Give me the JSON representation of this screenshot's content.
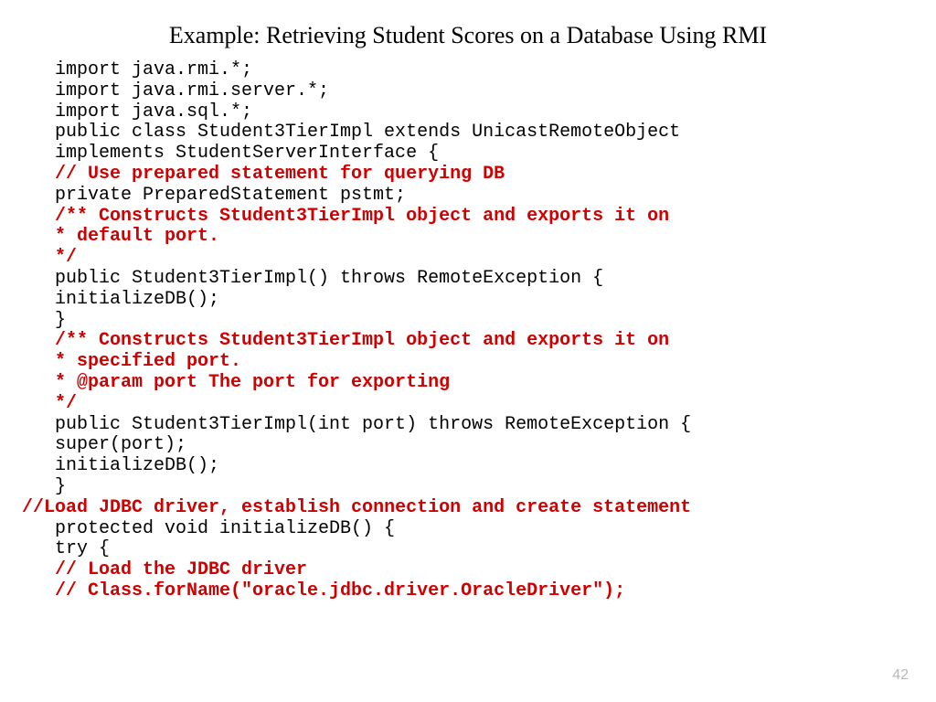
{
  "title": "Example: Retrieving Student Scores on a Database Using RMI",
  "lines": [
    {
      "t": "import java.rmi.*;",
      "cls": ""
    },
    {
      "t": "import java.rmi.server.*;",
      "cls": ""
    },
    {
      "t": "import java.sql.*;",
      "cls": ""
    },
    {
      "t": "public class Student3TierImpl extends UnicastRemoteObject",
      "cls": ""
    },
    {
      "t": "implements StudentServerInterface {",
      "cls": ""
    },
    {
      "t": "// Use prepared statement for querying DB",
      "cls": "red"
    },
    {
      "t": "private PreparedStatement pstmt;",
      "cls": ""
    },
    {
      "t": "/** Constructs Student3TierImpl object and exports it on",
      "cls": "red"
    },
    {
      "t": "* default port.",
      "cls": "red"
    },
    {
      "t": "*/",
      "cls": "red"
    },
    {
      "t": "public Student3TierImpl() throws RemoteException {",
      "cls": ""
    },
    {
      "t": "initializeDB();",
      "cls": ""
    },
    {
      "t": "}",
      "cls": ""
    },
    {
      "t": "/** Constructs Student3TierImpl object and exports it on",
      "cls": "red"
    },
    {
      "t": "* specified port.",
      "cls": "red"
    },
    {
      "t": "* @param port The port for exporting",
      "cls": "red"
    },
    {
      "t": "*/",
      "cls": "red"
    },
    {
      "t": "public Student3TierImpl(int port) throws RemoteException {",
      "cls": ""
    },
    {
      "t": "super(port);",
      "cls": ""
    },
    {
      "t": "initializeDB();",
      "cls": ""
    },
    {
      "t": "}",
      "cls": ""
    },
    {
      "t": "//Load JDBC driver, establish connection and create statement",
      "cls": "red outdent"
    },
    {
      "t": "protected void initializeDB() {",
      "cls": ""
    },
    {
      "t": "try {",
      "cls": ""
    },
    {
      "t": "// Load the JDBC driver",
      "cls": "red"
    },
    {
      "t": "// Class.forName(\"oracle.jdbc.driver.OracleDriver\");",
      "cls": "red"
    }
  ],
  "pagenum": "42"
}
